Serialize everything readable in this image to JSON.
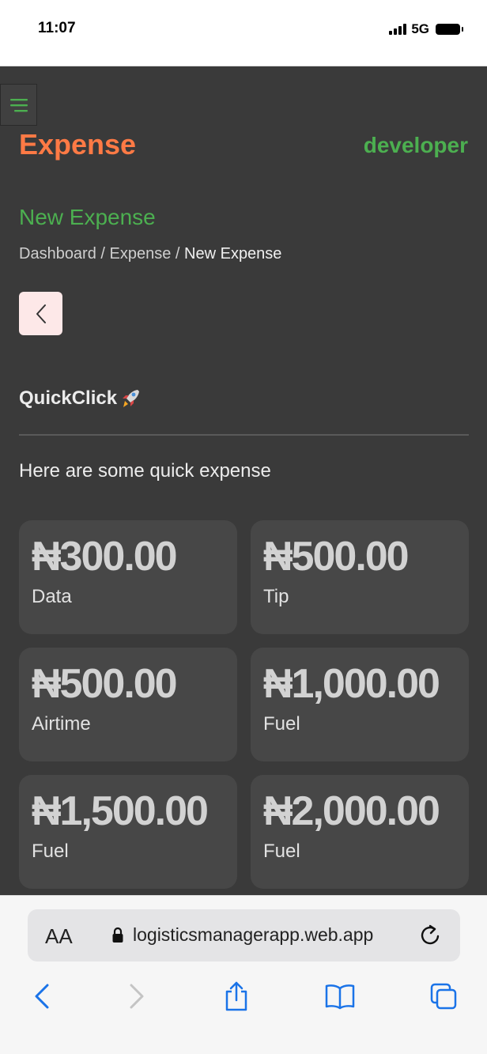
{
  "status_bar": {
    "time": "11:07",
    "network": "5G"
  },
  "app": {
    "title": "Expense",
    "user": "developer",
    "page_title": "New Expense",
    "breadcrumb": {
      "items": [
        "Dashboard",
        "Expense",
        "New Expense"
      ],
      "separator": " / "
    },
    "quickclick": {
      "title": "QuickClick",
      "description": "Here are some quick expense"
    },
    "quick_expenses": [
      {
        "amount": "₦300.00",
        "label": "Data"
      },
      {
        "amount": "₦500.00",
        "label": "Tip"
      },
      {
        "amount": "₦500.00",
        "label": "Airtime"
      },
      {
        "amount": "₦1,000.00",
        "label": "Fuel"
      },
      {
        "amount": "₦1,500.00",
        "label": "Fuel"
      },
      {
        "amount": "₦2,000.00",
        "label": "Fuel"
      }
    ]
  },
  "browser": {
    "text_size_label": "AA",
    "url": "logisticsmanagerapp.web.app"
  },
  "colors": {
    "accent_orange": "#ff7a45",
    "accent_green": "#4caf50",
    "background": "#3a3a3a",
    "card": "#474747",
    "back_button": "#fde8e8",
    "link_blue": "#1a73e8"
  },
  "icons": {
    "menu": "hamburger-menu-icon",
    "back": "chevron-left-icon",
    "rocket": "rocket-icon",
    "lock": "lock-icon",
    "reload": "reload-icon",
    "nav_back": "chevron-left-icon",
    "nav_forward": "chevron-right-icon",
    "share": "share-icon",
    "bookmarks": "book-icon",
    "tabs": "tabs-icon"
  }
}
